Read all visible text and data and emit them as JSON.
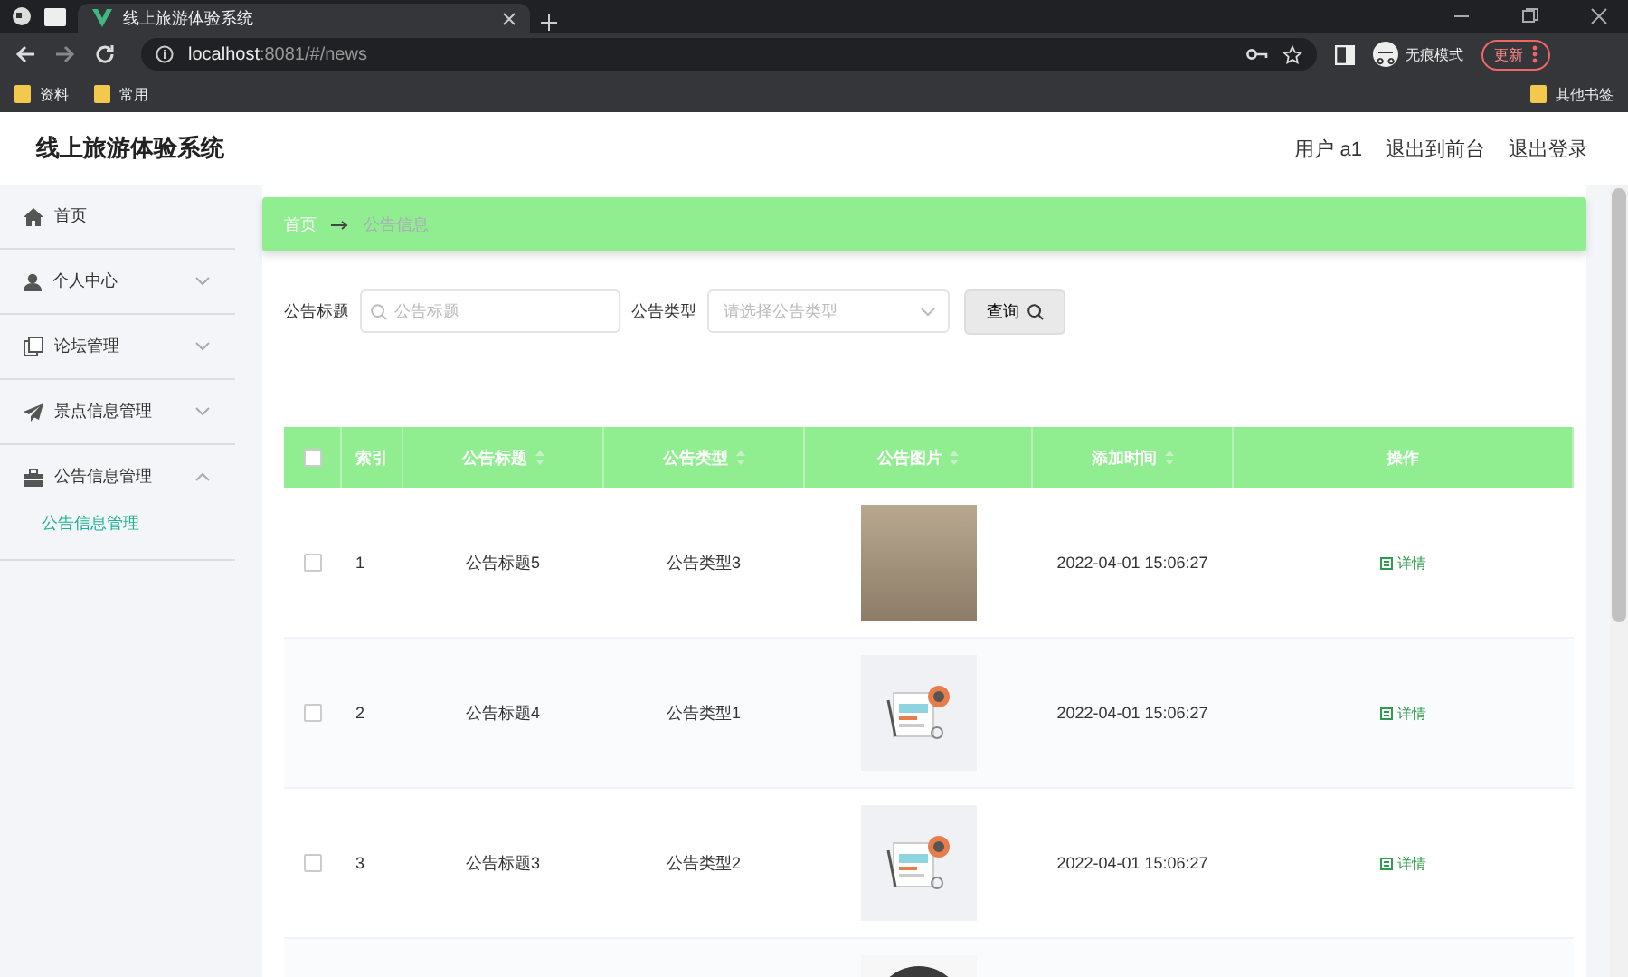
{
  "browser": {
    "tab_title": "线上旅游体验系统",
    "address_host": "localhost",
    "address_rest": ":8081/#/news",
    "profile_label": "无痕模式",
    "update_button": "更新",
    "bookmarks": [
      "资料",
      "常用"
    ],
    "other_bookmarks": "其他书签"
  },
  "header": {
    "title": "线上旅游体验系统",
    "links": [
      "用户 a1",
      "退出到前台",
      "退出登录"
    ]
  },
  "sidebar": {
    "items": [
      {
        "label": "首页",
        "kind": "link"
      },
      {
        "label": "个人中心",
        "kind": "menu",
        "expanded": false
      },
      {
        "label": "论坛管理",
        "kind": "menu",
        "expanded": false
      },
      {
        "label": "景点信息管理",
        "kind": "menu",
        "expanded": false
      },
      {
        "label": "公告信息管理",
        "kind": "menu",
        "expanded": true,
        "children": [
          {
            "label": "公告信息管理",
            "selected": true
          }
        ]
      }
    ]
  },
  "breadcrumb": [
    "首页",
    "公告信息"
  ],
  "search": {
    "title_label": "公告标题",
    "title_placeholder": "公告标题",
    "type_label": "公告类型",
    "type_placeholder": "请选择公告类型",
    "button": "查询"
  },
  "table": {
    "columns": [
      {
        "label": "索引",
        "sortable": false
      },
      {
        "label": "公告标题",
        "sortable": true
      },
      {
        "label": "公告类型",
        "sortable": true
      },
      {
        "label": "公告图片",
        "sortable": true
      },
      {
        "label": "添加时间",
        "sortable": true
      },
      {
        "label": "操作",
        "sortable": false
      }
    ],
    "header_checked": false,
    "rows": [
      {
        "checked": false,
        "index": "1",
        "title": "公告标题5",
        "type": "公告类型3",
        "image": {
          "kind": "photo"
        },
        "time": "2022-04-01 15:06:27",
        "action": "详情"
      },
      {
        "checked": false,
        "index": "2",
        "title": "公告标题4",
        "type": "公告类型1",
        "image": {
          "kind": "illustration"
        },
        "time": "2022-04-01 15:06:27",
        "action": "详情"
      },
      {
        "checked": false,
        "index": "3",
        "title": "公告标题3",
        "type": "公告类型2",
        "image": {
          "kind": "illustration"
        },
        "time": "2022-04-01 15:06:27",
        "action": "详情"
      },
      {
        "image": {
          "kind": "dark"
        }
      }
    ]
  }
}
